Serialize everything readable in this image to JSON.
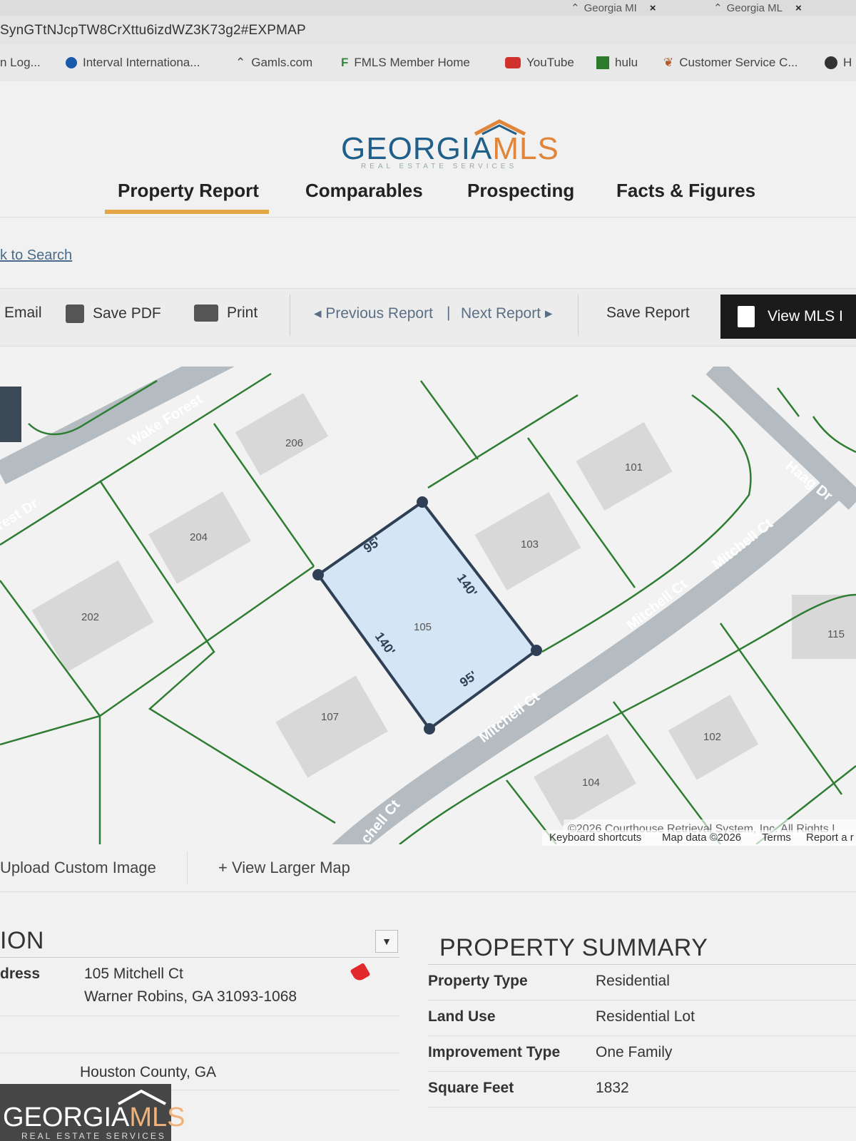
{
  "browser": {
    "tabs": [
      {
        "label": "Georgia MI",
        "close": "×"
      },
      {
        "label": "Georgia ML",
        "close": "×"
      }
    ],
    "url": "SynGTtNJcpTW8CrXttu6izdWZ3K73g2#EXPMAP",
    "bookmarks": [
      {
        "label": "n Log...",
        "icon": "none"
      },
      {
        "label": "Interval Internationa...",
        "icon": "blue-dot-icon"
      },
      {
        "label": "Gamls.com",
        "icon": "roof-icon"
      },
      {
        "label": "FMLS Member Home",
        "icon": "fmls-icon"
      },
      {
        "label": "YouTube",
        "icon": "youtube-icon"
      },
      {
        "label": "hulu",
        "icon": "hulu-icon"
      },
      {
        "label": "Customer Service C...",
        "icon": "squirrel-icon"
      },
      {
        "label": "H",
        "icon": "globe-icon"
      }
    ]
  },
  "logo": {
    "georgia": "GEORGIA",
    "mls": "MLS",
    "tagline": "REAL ESTATE SERVICES"
  },
  "nav": {
    "tabs": [
      "Property Report",
      "Comparables",
      "Prospecting",
      "Facts & Figures"
    ],
    "active": "Property Report"
  },
  "back_link": "k to Search",
  "toolbar": {
    "email": "Email",
    "save_pdf": "Save PDF",
    "print": "Print",
    "previous": "◂ Previous Report",
    "separator": "|",
    "next": "Next Report ▸",
    "save_report": "Save Report",
    "view_mls": "View MLS I"
  },
  "map": {
    "streets": [
      "Wake Forest",
      "rest Dr",
      "Haag Dr",
      "Mitchell Ct",
      "Mitchell Ct",
      "Mitchell Ct",
      "chell Ct"
    ],
    "lots": [
      "206",
      "204",
      "202",
      "101",
      "103",
      "105",
      "107",
      "115",
      "102",
      "104"
    ],
    "dimensions": [
      "95'",
      "140'",
      "140'",
      "95'"
    ],
    "copyright": "©2026 Courthouse Retrieval System, Inc. All Rights I",
    "footer_links": [
      "Keyboard shortcuts",
      "Map data ©2026",
      "Terms",
      "Report a r"
    ]
  },
  "map_actions": {
    "upload": "Upload Custom Image",
    "larger": "+ View Larger Map"
  },
  "location": {
    "title": "ION",
    "address_label": "dress",
    "address_line1": "105 Mitchell Ct",
    "address_line2": "Warner Robins, GA 31093-1068",
    "county": "Houston County, GA"
  },
  "summary": {
    "title": "PROPERTY SUMMARY",
    "rows": [
      {
        "k": "Property Type",
        "v": "Residential"
      },
      {
        "k": "Land Use",
        "v": "Residential Lot"
      },
      {
        "k": "Improvement Type",
        "v": "One Family"
      },
      {
        "k": "Square Feet",
        "v": "1832"
      }
    ]
  },
  "colors": {
    "accent": "#e4a545",
    "brand_blue": "#1f5f8a",
    "brand_orange": "#e0853a",
    "lot_line": "#2e7d32",
    "parcel_fill": "#d4e6f5",
    "road": "#b4bcc2"
  }
}
